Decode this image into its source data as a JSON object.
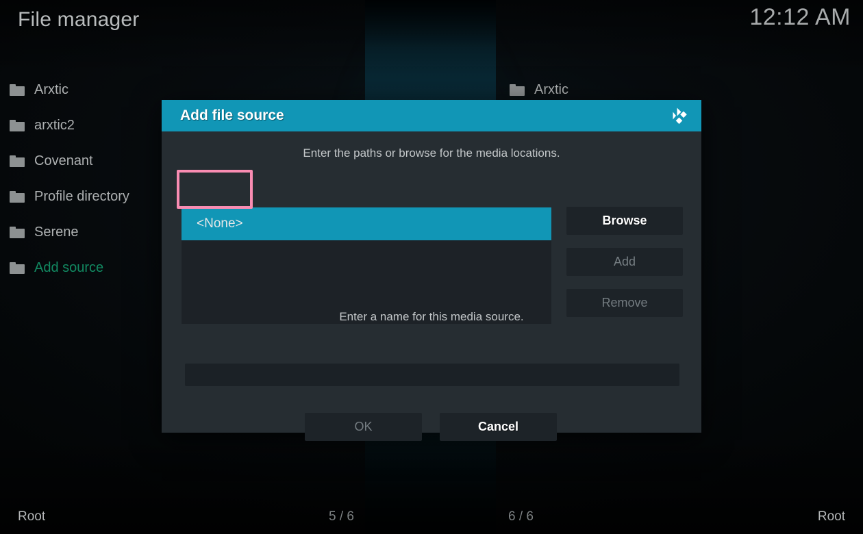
{
  "window": {
    "app_title": "File manager",
    "clock": "12:12 AM"
  },
  "panes": {
    "left": {
      "items": [
        {
          "label": "Arxtic",
          "icon": "folder-icon",
          "accent": false
        },
        {
          "label": "arxtic2",
          "icon": "folder-icon",
          "accent": false
        },
        {
          "label": "Covenant",
          "icon": "folder-icon",
          "accent": false
        },
        {
          "label": "Profile directory",
          "icon": "folder-icon",
          "accent": false
        },
        {
          "label": "Serene",
          "icon": "folder-icon",
          "accent": false
        },
        {
          "label": "Add source",
          "icon": "folder-icon",
          "accent": true
        }
      ]
    },
    "right": {
      "items": [
        {
          "label": "Arxtic",
          "icon": "folder-icon",
          "accent": false
        }
      ]
    }
  },
  "statusbar": {
    "left_path": "Root",
    "left_count": "5 / 6",
    "right_count": "6 / 6",
    "right_path": "Root"
  },
  "dialog": {
    "title": "Add file source",
    "logo_icon": "kodi-logo-icon",
    "paths_hint": "Enter the paths or browse for the media locations.",
    "path_list": [
      {
        "label": "<None>",
        "selected": true
      }
    ],
    "side_buttons": [
      {
        "label": "Browse",
        "enabled": true
      },
      {
        "label": "Add",
        "enabled": false
      },
      {
        "label": "Remove",
        "enabled": false
      }
    ],
    "name_hint": "Enter a name for this media source.",
    "name_value": "",
    "name_placeholder": "",
    "footer_buttons": [
      {
        "label": "OK",
        "enabled": false
      },
      {
        "label": "Cancel",
        "enabled": true
      }
    ]
  },
  "colors": {
    "accent_teal": "#1196b6",
    "dialog_bg": "#262d32",
    "list_bg": "#1d2227",
    "button_bg": "#1d2328",
    "green_accent": "#128a62",
    "annotation_pink": "#f98cb2",
    "text_primary": "#aeb1b2",
    "text_disabled": "#757d82"
  },
  "annotation": {
    "target": "path-list-item-none",
    "shape": "rectangle",
    "color": "#f98cb2"
  }
}
